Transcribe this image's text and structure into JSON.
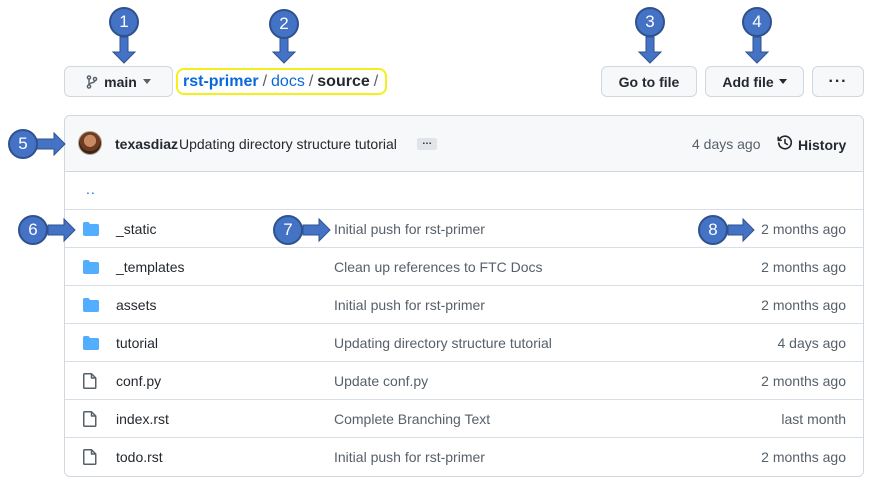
{
  "toolbar": {
    "branch_label": "main",
    "goto_file_label": "Go to file",
    "add_file_label": "Add file",
    "more_label": "···"
  },
  "breadcrumb": {
    "repo": "rst-primer",
    "docs": "docs",
    "source": "source",
    "separator": "/"
  },
  "commit": {
    "author": "texasdiaz",
    "message": "Updating directory structure tutorial",
    "ellipsis": "…",
    "time": "4 days ago",
    "history_label": "History"
  },
  "parent_link": "..",
  "files": [
    {
      "type": "folder",
      "name": "_static",
      "message": "Initial push for rst-primer",
      "age": "2 months ago"
    },
    {
      "type": "folder",
      "name": "_templates",
      "message": "Clean up references to FTC Docs",
      "age": "2 months ago"
    },
    {
      "type": "folder",
      "name": "assets",
      "message": "Initial push for rst-primer",
      "age": "2 months ago"
    },
    {
      "type": "folder",
      "name": "tutorial",
      "message": "Updating directory structure tutorial",
      "age": "4 days ago"
    },
    {
      "type": "file",
      "name": "conf.py",
      "message": "Update conf.py",
      "age": "2 months ago"
    },
    {
      "type": "file",
      "name": "index.rst",
      "message": "Complete Branching Text",
      "age": "last month"
    },
    {
      "type": "file",
      "name": "todo.rst",
      "message": "Initial push for rst-primer",
      "age": "2 months ago"
    }
  ],
  "markers": [
    "1",
    "2",
    "3",
    "4",
    "5",
    "6",
    "7",
    "8"
  ],
  "colors": {
    "link": "#0969da",
    "folder": "#54aeff",
    "marker": "#4472c4",
    "highlight": "#f4f01c"
  }
}
